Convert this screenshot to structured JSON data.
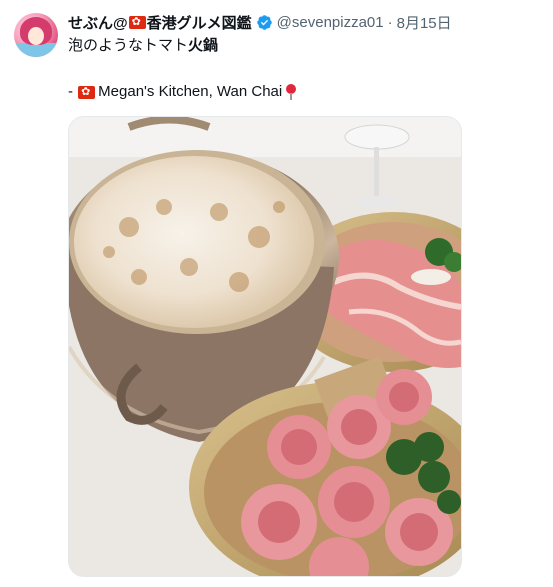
{
  "author": {
    "display_name_part1": "せぶん@",
    "display_name_part2": "香港グルメ図鑑",
    "handle": "@sevenpizza01",
    "separator": "·",
    "date": "8月15日",
    "verified": true,
    "avatar_icon": "anime-avatar"
  },
  "tweet": {
    "line1_plain": "泡のようなトマト",
    "line1_bold": "火鍋",
    "line2_prefix": "- ",
    "line2_text": "Megan's Kitchen, Wan Chai",
    "line2_emoji": "round-pushpin-icon",
    "flag_emoji": "hong-kong-flag-icon"
  },
  "media": {
    "type": "photo",
    "subject": "tomato-foam-hotpot-with-meat-plates"
  },
  "colors": {
    "text_primary": "#0f1419",
    "text_secondary": "#536471",
    "verified_blue": "#1d9bf0",
    "flag_red": "#de2910"
  }
}
